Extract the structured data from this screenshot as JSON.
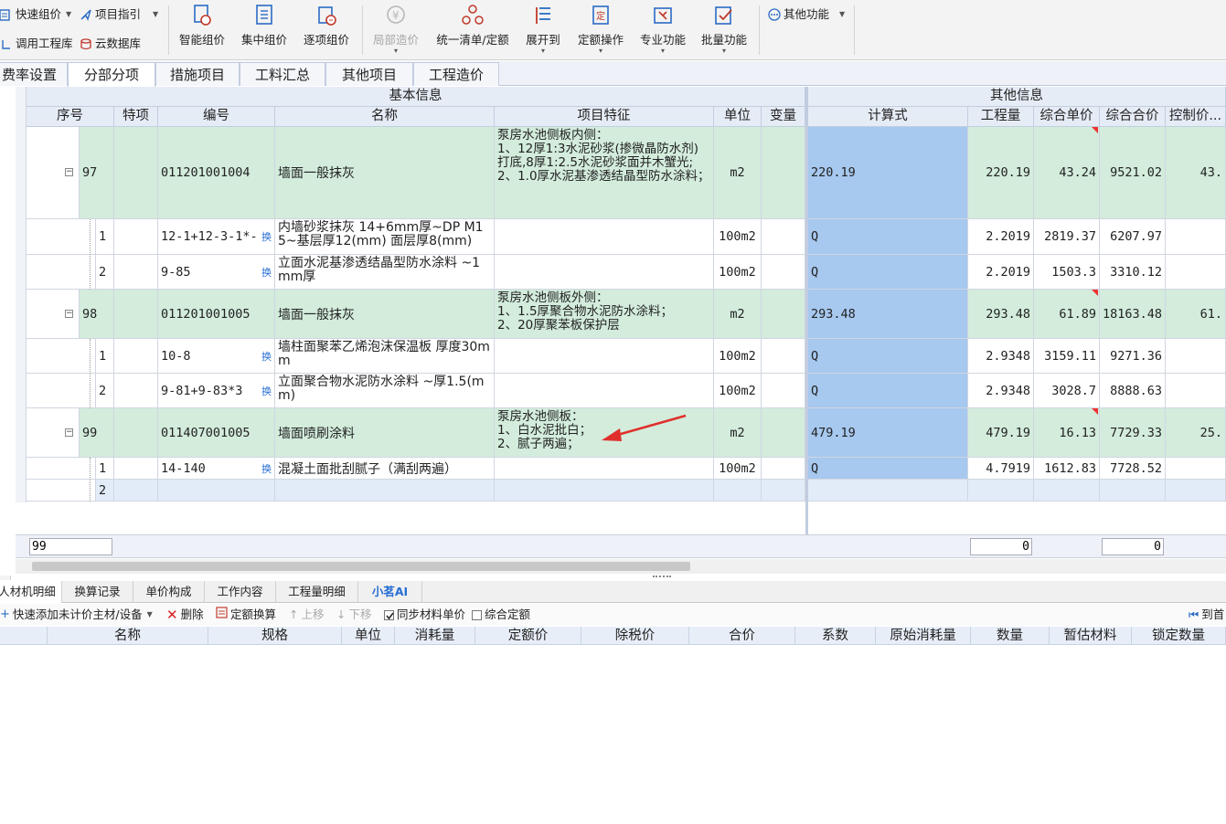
{
  "ribbon": {
    "small": [
      {
        "label": "快速组价",
        "icon": "quick-price-icon"
      },
      {
        "label": "项目指引",
        "icon": "guide-icon"
      },
      {
        "label": "调用工程库",
        "icon": "project-lib-icon"
      },
      {
        "label": "云数据库",
        "icon": "cloud-db-icon"
      }
    ],
    "big": [
      {
        "label": "智能组价",
        "icon": "smart-price-icon",
        "disabled": false
      },
      {
        "label": "集中组价",
        "icon": "batch-price-icon",
        "disabled": false
      },
      {
        "label": "逐项组价",
        "icon": "item-price-icon",
        "disabled": false
      },
      {
        "label": "局部造价",
        "icon": "partial-cost-icon",
        "disabled": true
      },
      {
        "label": "统一清单/定额",
        "icon": "unify-list-icon",
        "disabled": false
      },
      {
        "label": "展开到",
        "icon": "expand-to-icon",
        "disabled": false
      },
      {
        "label": "定额操作",
        "icon": "quota-op-icon",
        "disabled": false
      },
      {
        "label": "专业功能",
        "icon": "pro-func-icon",
        "disabled": false
      },
      {
        "label": "批量功能",
        "icon": "bulk-func-icon",
        "disabled": false
      }
    ],
    "other": "其他功能"
  },
  "tabs": [
    "费率设置",
    "分部分项",
    "措施项目",
    "工料汇总",
    "其他项目",
    "工程造价"
  ],
  "active_tab": "分部分项",
  "grid": {
    "group_basic": "基本信息",
    "group_other": "其他信息",
    "columns": [
      "序号",
      "特项",
      "编号",
      "名称",
      "项目特征",
      "单位",
      "变量",
      "计算式",
      "工程量",
      "综合单价",
      "综合合价",
      "控制价..."
    ],
    "rows": [
      {
        "type": "list",
        "seq": "97",
        "code": "011201001004",
        "name": "墙面一般抹灰",
        "feature": "泵房水池侧板内侧：\n1、12厚1:3水泥砂浆(掺微晶防水剂)打底,8厚1:2.5水泥砂浆面并木蟹光;\n2、1.0厚水泥基渗透结晶型防水涂料；",
        "unit": "m2",
        "formula": "220.19",
        "qty": "220.19",
        "price": "43.24",
        "total": "9521.02",
        "ctrl": "43."
      },
      {
        "type": "quota",
        "seq": "1",
        "code": "12-1+12-3-1*-",
        "name": "内墙砂浆抹灰 14+6mm厚~DP M15~基层厚12(mm) 面层厚8(mm)",
        "feature": "",
        "unit": "100m2",
        "formula": "Q",
        "qty": "2.2019",
        "price": "2819.37",
        "total": "6207.97",
        "ctrl": ""
      },
      {
        "type": "quota",
        "seq": "2",
        "code": "9-85",
        "name": "立面水泥基渗透结晶型防水涂料 ~1mm厚",
        "feature": "",
        "unit": "100m2",
        "formula": "Q",
        "qty": "2.2019",
        "price": "1503.3",
        "total": "3310.12",
        "ctrl": ""
      },
      {
        "type": "list",
        "seq": "98",
        "code": "011201001005",
        "name": "墙面一般抹灰",
        "feature": "泵房水池侧板外侧：\n1、1.5厚聚合物水泥防水涂料；\n2、20厚聚苯板保护层",
        "unit": "m2",
        "formula": "293.48",
        "qty": "293.48",
        "price": "61.89",
        "total": "18163.48",
        "ctrl": "61."
      },
      {
        "type": "quota",
        "seq": "1",
        "code": "10-8",
        "name": "墙柱面聚苯乙烯泡沫保温板 厚度30mm",
        "feature": "",
        "unit": "100m2",
        "formula": "Q",
        "qty": "2.9348",
        "price": "3159.11",
        "total": "9271.36",
        "ctrl": ""
      },
      {
        "type": "quota",
        "seq": "2",
        "code": "9-81+9-83*3",
        "name": "立面聚合物水泥防水涂料 ~厚1.5(mm)",
        "feature": "",
        "unit": "100m2",
        "formula": "Q",
        "qty": "2.9348",
        "price": "3028.7",
        "total": "8888.63",
        "ctrl": ""
      },
      {
        "type": "list",
        "seq": "99",
        "code": "011407001005",
        "name": "墙面喷刷涂料",
        "feature": "泵房水池侧板：\n1、白水泥批白；\n2、腻子两遍；",
        "unit": "m2",
        "formula": "479.19",
        "qty": "479.19",
        "price": "16.13",
        "total": "7729.33",
        "ctrl": "25."
      },
      {
        "type": "quota",
        "seq": "1",
        "code": "14-140",
        "name": "混凝土面批刮腻子（满刮两遍）",
        "feature": "",
        "unit": "100m2",
        "formula": "Q",
        "qty": "4.7919",
        "price": "1612.83",
        "total": "7728.52",
        "ctrl": ""
      },
      {
        "type": "empty",
        "seq": "2",
        "code": "",
        "name": "",
        "feature": "",
        "unit": "",
        "formula": "",
        "qty": "",
        "price": "",
        "total": "",
        "ctrl": ""
      }
    ],
    "huan": "换",
    "footer_input": "99",
    "footer_qty": "0",
    "footer_total": "0"
  },
  "bottom": {
    "tabs": [
      "人材机明细",
      "换算记录",
      "单价构成",
      "工作内容",
      "工程量明细",
      "小茗AI"
    ],
    "toolbar": {
      "add": "快速添加未计价主材/设备",
      "delete": "删除",
      "convert": "定额换算",
      "up": "上移",
      "down": "下移",
      "sync": "同步材料单价",
      "combined": "综合定额",
      "to_first": "到首"
    },
    "columns": [
      "名称",
      "规格",
      "单位",
      "消耗量",
      "定额价",
      "除税价",
      "合价",
      "系数",
      "原始消耗量",
      "数量",
      "暂估材料",
      "锁定数量"
    ]
  },
  "colors": {
    "list_row": "#d3ecdc",
    "formula": "#a7c8ef",
    "annotation_arrow": "#e0302c"
  }
}
